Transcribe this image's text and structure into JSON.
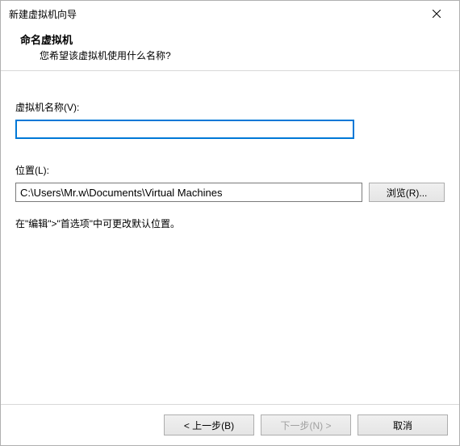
{
  "window": {
    "title": "新建虚拟机向导"
  },
  "header": {
    "title": "命名虚拟机",
    "description": "您希望该虚拟机使用什么名称?"
  },
  "form": {
    "name_label": "虚拟机名称(V):",
    "name_value": "",
    "location_label": "位置(L):",
    "location_value": "C:\\Users\\Mr.w\\Documents\\Virtual Machines",
    "browse_label": "浏览(R)...",
    "hint": "在\"编辑\">\"首选项\"中可更改默认位置。"
  },
  "footer": {
    "back": "< 上一步(B)",
    "next": "下一步(N) >",
    "cancel": "取消"
  }
}
